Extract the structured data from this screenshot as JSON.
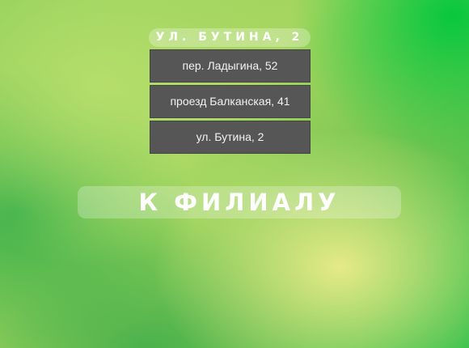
{
  "branch_select": {
    "selected_label": "УЛ. БУТИНА, 2",
    "options": [
      "пер. Ладыгина, 52",
      "проезд Балканская, 41",
      "ул. Бутина, 2"
    ]
  },
  "actions": {
    "go_to_branch_label": "К ФИЛИАЛУ"
  },
  "colors": {
    "option_background": "#565656",
    "option_text": "#f2f2f2",
    "button_text": "#ffffff"
  }
}
